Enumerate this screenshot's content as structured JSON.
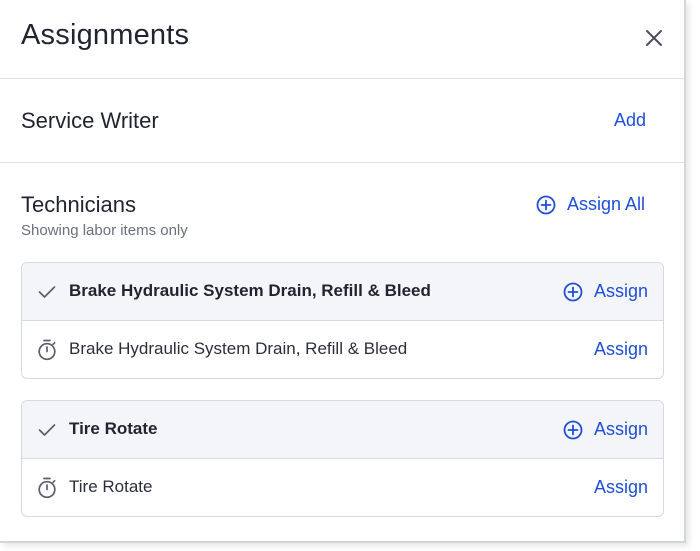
{
  "dialog": {
    "title": "Assignments",
    "close_icon": "close-icon"
  },
  "service_writer": {
    "title": "Service Writer",
    "add_label": "Add"
  },
  "technicians": {
    "title": "Technicians",
    "subtitle": "Showing labor items only",
    "assign_all_label": "Assign All",
    "items": [
      {
        "header_label": "Brake Hydraulic System Drain, Refill & Bleed",
        "header_assign_label": "Assign",
        "labor_label": "Brake Hydraulic System Drain, Refill & Bleed",
        "labor_assign_label": "Assign"
      },
      {
        "header_label": "Tire Rotate",
        "header_assign_label": "Assign",
        "labor_label": "Tire Rotate",
        "labor_assign_label": "Assign"
      }
    ]
  },
  "colors": {
    "accent": "#1f4fd6",
    "text": "#1f2430",
    "muted": "#6b7080",
    "row_header_bg": "#f4f5f8",
    "border": "#d5d9e0"
  }
}
